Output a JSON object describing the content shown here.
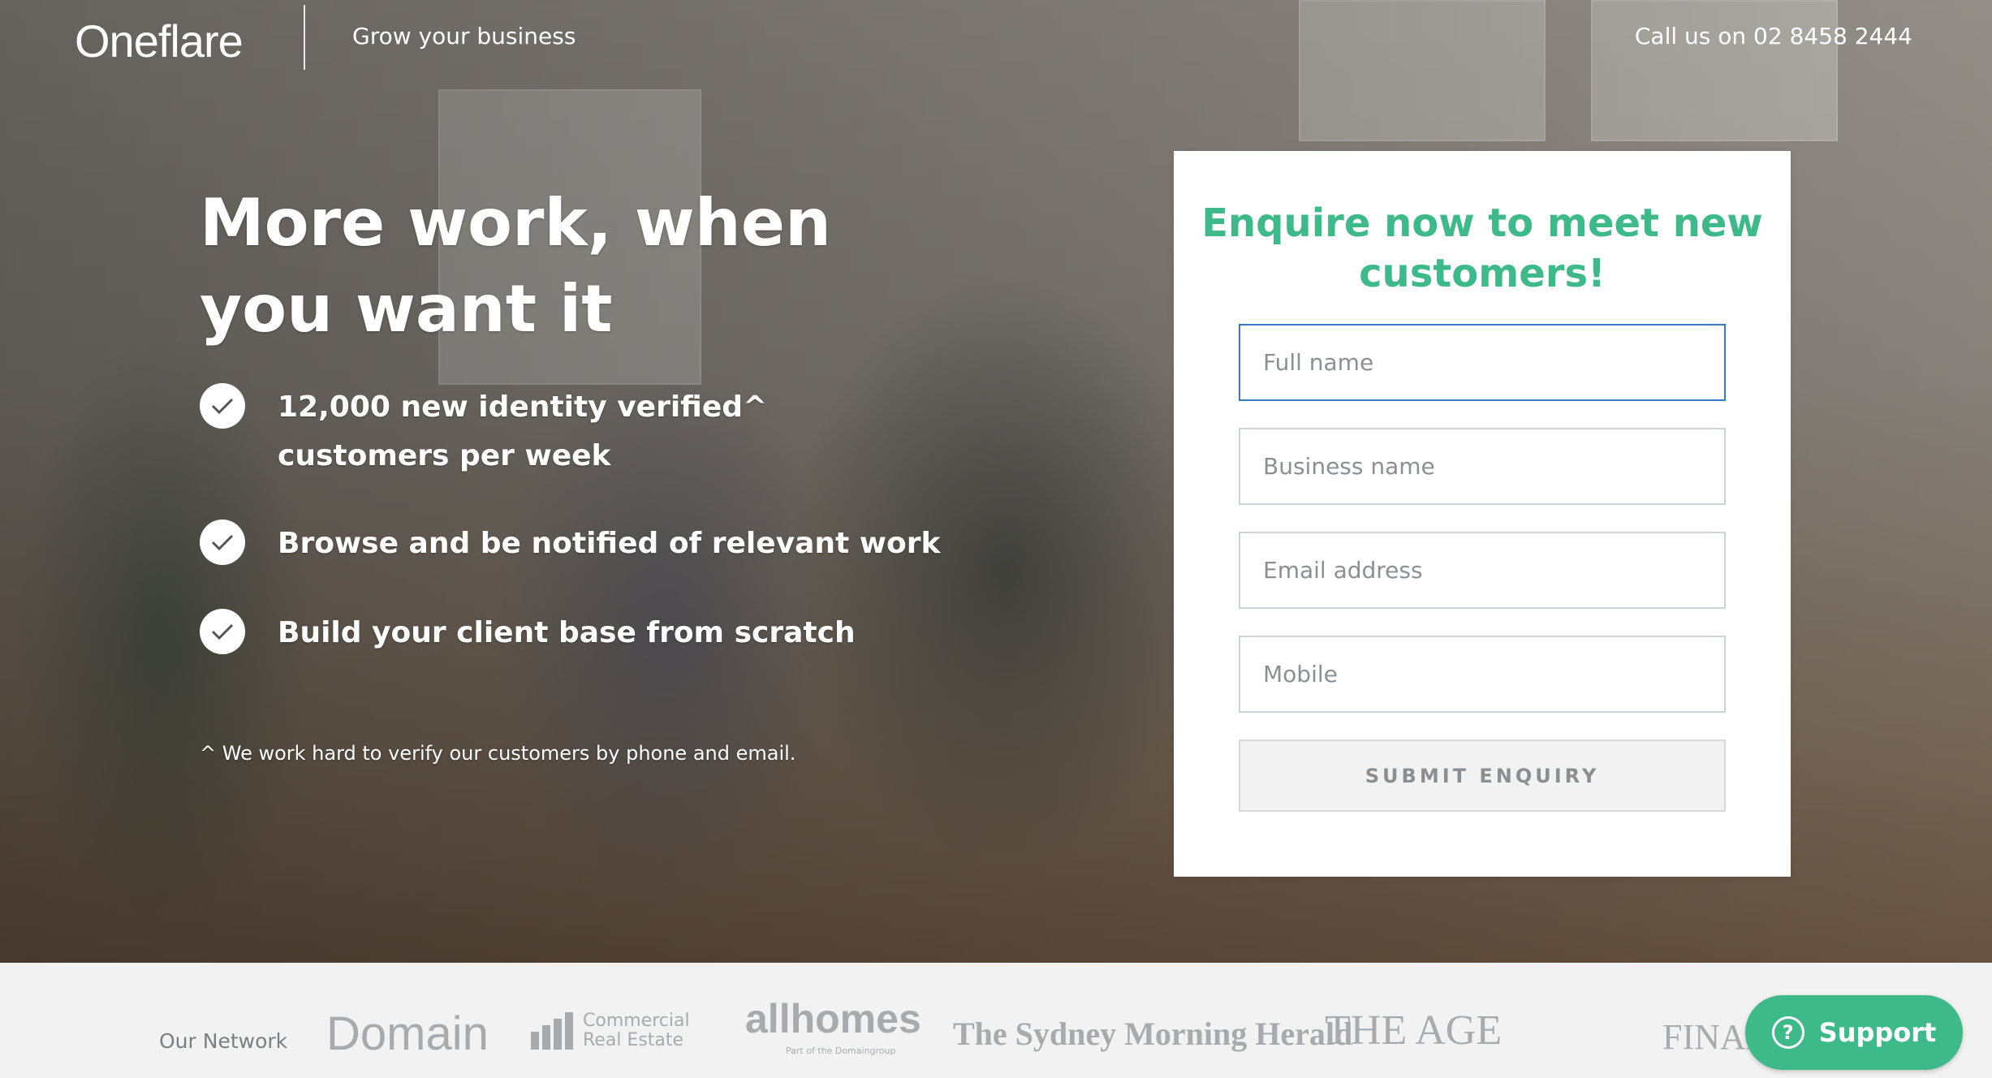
{
  "header": {
    "logo": "Oneflare",
    "tagline": "Grow your business",
    "phone": "Call us on 02 8458 2444"
  },
  "hero": {
    "headline": "More work, when you want it",
    "bullets": [
      "12,000 new identity verified^ customers per week",
      "Browse and be notified of relevant work",
      "Build your client base from scratch"
    ],
    "footnote": "^ We work hard to verify our customers by phone and email."
  },
  "form": {
    "title": "Enquire now to meet new customers!",
    "fields": [
      {
        "placeholder": "Full name",
        "value": ""
      },
      {
        "placeholder": "Business name",
        "value": ""
      },
      {
        "placeholder": "Email address",
        "value": ""
      },
      {
        "placeholder": "Mobile",
        "value": ""
      }
    ],
    "submit_label": "SUBMIT ENQUIRY"
  },
  "network": {
    "label": "Our Network",
    "logos": {
      "domain": "Domain",
      "cre_line1": "Commercial",
      "cre_line2": "Real Estate",
      "allhomes": "allhomes",
      "allhomes_sub": "Part of the Domaingroup",
      "smh": "The Sydney Morning Herald",
      "age": "THE AGE",
      "fin": "FINANC"
    }
  },
  "support": {
    "label": "Support"
  },
  "colors": {
    "accent": "#3db98a",
    "focus": "#3a78c7"
  },
  "icons": {
    "check": "check-icon",
    "support": "question-circle-icon"
  }
}
